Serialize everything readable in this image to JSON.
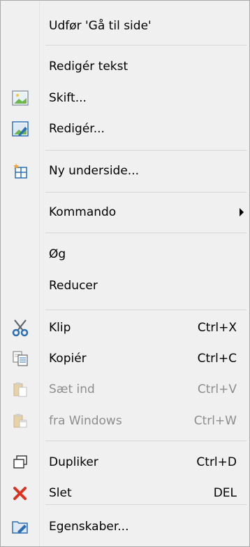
{
  "menu": {
    "items": [
      {
        "label": "Udfør 'Gå til side'",
        "shortcut": "",
        "icon": "",
        "disabled": false
      },
      {
        "label": "Redigér tekst",
        "shortcut": "",
        "icon": "",
        "disabled": false
      },
      {
        "label": "Skift...",
        "shortcut": "",
        "icon": "image-icon",
        "disabled": false
      },
      {
        "label": "Redigér...",
        "shortcut": "",
        "icon": "image-edit-icon",
        "disabled": false
      },
      {
        "label": "Ny underside...",
        "shortcut": "",
        "icon": "new-page-icon",
        "disabled": false
      },
      {
        "label": "Kommando",
        "shortcut": "",
        "icon": "",
        "disabled": false,
        "submenu": true
      },
      {
        "label": "Øg",
        "shortcut": "",
        "icon": "",
        "disabled": false
      },
      {
        "label": "Reducer",
        "shortcut": "",
        "icon": "",
        "disabled": false
      },
      {
        "label": "Klip",
        "shortcut": "Ctrl+X",
        "icon": "scissors-icon",
        "disabled": false
      },
      {
        "label": "Kopiér",
        "shortcut": "Ctrl+C",
        "icon": "copy-icon",
        "disabled": false
      },
      {
        "label": "Sæt ind",
        "shortcut": "Ctrl+V",
        "icon": "paste-icon",
        "disabled": true
      },
      {
        "label": "fra Windows",
        "shortcut": "Ctrl+W",
        "icon": "paste-windows-icon",
        "disabled": true
      },
      {
        "label": "Dupliker",
        "shortcut": "Ctrl+D",
        "icon": "duplicate-icon",
        "disabled": false
      },
      {
        "label": "Slet",
        "shortcut": "DEL",
        "icon": "delete-icon",
        "disabled": false
      },
      {
        "label": "Egenskaber...",
        "shortcut": "",
        "icon": "properties-icon",
        "disabled": false
      }
    ]
  },
  "colors": {
    "menu_background": "#f0f0f0",
    "separator": "#d7d7d7",
    "disabled_text": "#8d8d8d",
    "delete_icon": "#e0301e",
    "accent_blue": "#2a6fb5"
  }
}
